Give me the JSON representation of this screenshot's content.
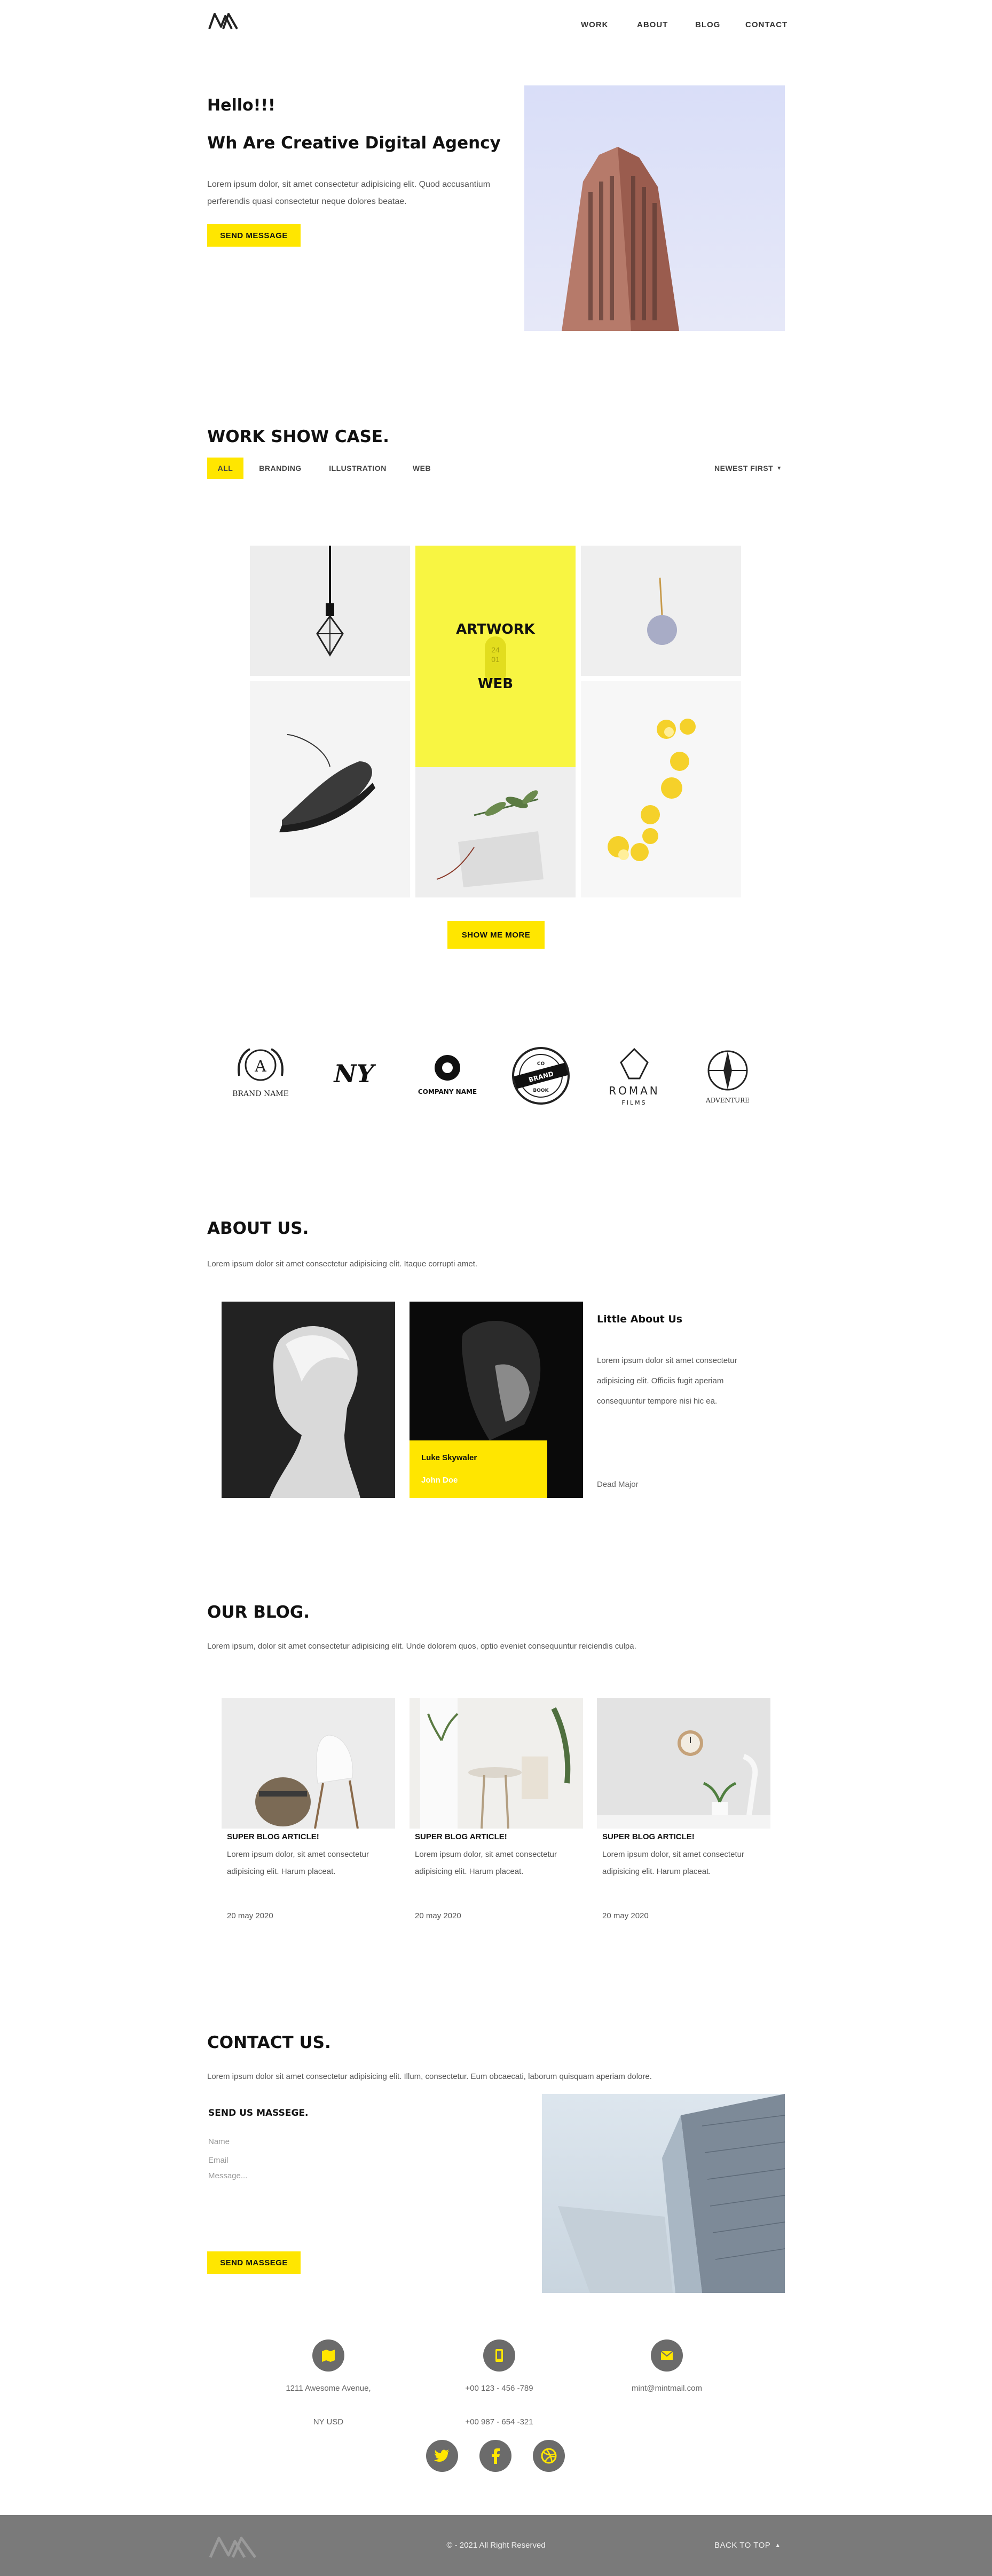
{
  "nav": {
    "work": "WORK",
    "about": "ABOUT",
    "blog": "BLOG",
    "contact": "CONTACT"
  },
  "hero": {
    "greeting": "Hello!!!",
    "title": "Wh Are Creative Digital Agency",
    "text": "Lorem ipsum dolor, sit amet consectetur adipisicing elit. Quod accusantium perferendis quasi consectetur neque dolores beatae.",
    "button": "SEND MESSAGE"
  },
  "work": {
    "title": "WORK SHOW CASE.",
    "filters": [
      "ALL",
      "BRANDING",
      "ILLUSTRATION",
      "WEB"
    ],
    "sort": "NEWEST FIRST",
    "feature": {
      "line1": "ARTWORK",
      "line2": "WEB",
      "tag": "24\n01"
    },
    "show_more": "SHOW ME MORE"
  },
  "logos": {
    "brand": {
      "letter": "A",
      "name": "BRAND NAME"
    },
    "ny": "NY",
    "company": "COMPANY NAME",
    "stamp": [
      "BRAND",
      "CO",
      "BOOK"
    ],
    "roman": {
      "line1": "ROMAN",
      "line2": "FILMS"
    },
    "adventure": "ADVENTURE"
  },
  "about": {
    "title": "ABOUT US.",
    "text": "Lorem ipsum dolor sit amet consectetur adipisicing elit. Itaque corrupti amet.",
    "card_name": "Luke Skywaler",
    "card_role": "John Doe",
    "side_title": "Little About Us",
    "side_text": "Lorem ipsum dolor sit amet consectetur adipisicing elit. Officiis fugit aperiam consequuntur tempore nisi hic ea.",
    "side_sign": "Dead Major"
  },
  "blog": {
    "title": "OUR BLOG.",
    "text": "Lorem ipsum, dolor sit amet consectetur adipisicing elit. Unde dolorem quos, optio eveniet consequuntur reiciendis culpa.",
    "posts": [
      {
        "title": "SUPER BLOG ARTICLE!",
        "text": "Lorem ipsum dolor, sit amet consectetur adipisicing elit. Harum placeat.",
        "date": "20 may 2020"
      },
      {
        "title": "SUPER BLOG ARTICLE!",
        "text": "Lorem ipsum dolor, sit amet consectetur adipisicing elit. Harum placeat.",
        "date": "20 may 2020"
      },
      {
        "title": "SUPER BLOG ARTICLE!",
        "text": "Lorem ipsum dolor, sit amet consectetur adipisicing elit. Harum placeat.",
        "date": "20 may 2020"
      }
    ]
  },
  "contact": {
    "title": "CONTACT US.",
    "text": "Lorem ipsum dolor sit amet consectetur adipisicing elit. Illum, consectetur. Eum obcaecati, laborum quisquam aperiam dolore.",
    "form_title": "SEND US MASSEGE.",
    "name_ph": "Name",
    "email_ph": "Email",
    "message_ph": "Message...",
    "button": "SEND MASSEGE",
    "address1": "1211 Awesome Avenue,",
    "address2": "NY USD",
    "phone1": "+00 123 - 456 -789",
    "phone2": "+00 987 - 654 -321",
    "email": "mint@mintmail.com"
  },
  "footer": {
    "copyright": "© - 2021 All Right Reserved",
    "back_to_top": "BACK TO TOP"
  },
  "colors": {
    "accent": "#ffe600",
    "footer": "#7a7a7a",
    "dark": "#111111"
  }
}
